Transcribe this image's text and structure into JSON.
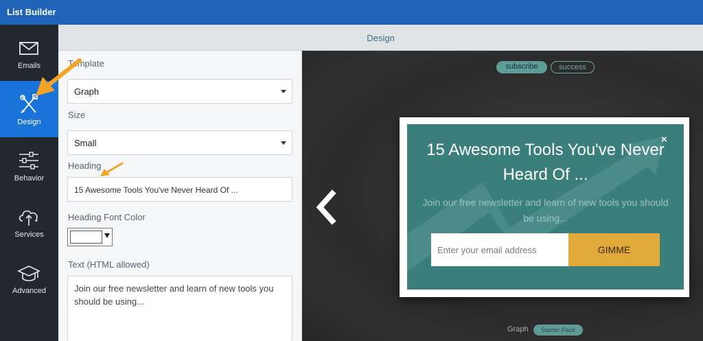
{
  "app": {
    "title": "List Builder"
  },
  "sidebar": {
    "items": [
      {
        "label": "Emails",
        "icon": "envelope-icon"
      },
      {
        "label": "Design",
        "icon": "design-tools-icon",
        "active": true
      },
      {
        "label": "Behavior",
        "icon": "sliders-icon"
      },
      {
        "label": "Services",
        "icon": "cloud-upload-icon"
      },
      {
        "label": "Advanced",
        "icon": "graduation-cap-icon"
      }
    ]
  },
  "header": {
    "title": "Design"
  },
  "form": {
    "template": {
      "label": "Template",
      "value": "Graph"
    },
    "size": {
      "label": "Size",
      "value": "Small"
    },
    "heading": {
      "label": "Heading",
      "value": "15 Awesome Tools You've Never Heard Of ..."
    },
    "heading_font_color": {
      "label": "Heading Font Color",
      "value": "#ffffff"
    },
    "text": {
      "label": "Text (HTML allowed)",
      "value": "Join our free newsletter and learn of new tools you should be using..."
    }
  },
  "preview": {
    "tabs": [
      "subscribe",
      "success"
    ],
    "active_tab": "subscribe",
    "popup": {
      "heading": "15 Awesome Tools You've Never Heard Of ...",
      "text": "Join our free newsletter and learn of new tools you should be using...",
      "email_placeholder": "Enter your email address",
      "button_label": "GIMME",
      "close_symbol": "×"
    },
    "footer": {
      "template_name": "Graph",
      "badge": "Starter Pack"
    }
  },
  "colors": {
    "topbar": "#1f64b8",
    "sidebar": "#22282f",
    "sidebar_active": "#1a73d9",
    "popup_teal": "#3b7f7d",
    "button": "#e0a93a",
    "annotation_arrow": "#f2a424"
  }
}
